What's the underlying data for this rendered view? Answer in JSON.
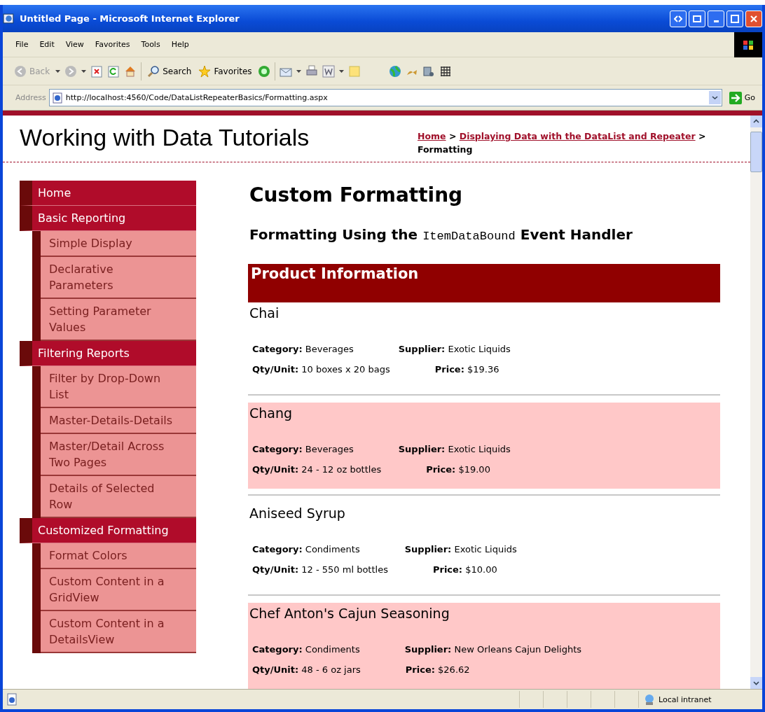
{
  "window": {
    "title": "Untitled Page - Microsoft Internet Explorer"
  },
  "menu": [
    "File",
    "Edit",
    "View",
    "Favorites",
    "Tools",
    "Help"
  ],
  "toolbar": {
    "back": "Back",
    "search": "Search",
    "favorites": "Favorites"
  },
  "address": {
    "label": "Address",
    "value": "http://localhost:4560/Code/DataListRepeaterBasics/Formatting.aspx",
    "go": "Go"
  },
  "site_title": "Working with Data Tutorials",
  "breadcrumb": [
    {
      "text": "Home",
      "kind": "link"
    },
    {
      "text": ">",
      "kind": "separator"
    },
    {
      "text": "Displaying Data with the DataList and Repeater",
      "kind": "link"
    },
    {
      "text": ">",
      "kind": "separator"
    },
    {
      "text": "Formatting",
      "kind": "current"
    }
  ],
  "sidebar": [
    {
      "label": "Home"
    },
    {
      "label": "Basic Reporting",
      "children": [
        "Simple Display",
        "Declarative Parameters",
        "Setting Parameter Values"
      ]
    },
    {
      "label": "Filtering Reports",
      "children": [
        "Filter by Drop-Down List",
        "Master-Details-Details",
        "Master/Detail Across Two Pages",
        "Details of Selected Row"
      ]
    },
    {
      "label": "Customized Formatting",
      "children": [
        "Format Colors",
        "Custom Content in a GridView",
        "Custom Content in a DetailsView"
      ]
    }
  ],
  "page_title": "Custom Formatting",
  "section_heading": [
    {
      "text": "Formatting Using the",
      "kind": "text"
    },
    {
      "text": "ItemDataBound",
      "kind": "code"
    },
    {
      "text": "Event Handler",
      "kind": "text"
    }
  ],
  "list_header": "Product Information",
  "products": [
    {
      "name": "Chai",
      "highlighted": false,
      "fields": [
        {
          "label": "Category:",
          "value": "Beverages"
        },
        {
          "label": "Supplier:",
          "value": "Exotic Liquids"
        },
        {
          "label": "Qty/Unit:",
          "value": "10 boxes x 20 bags"
        },
        {
          "label": "Price:",
          "value": "$19.36"
        }
      ]
    },
    {
      "name": "Chang",
      "highlighted": true,
      "fields": [
        {
          "label": "Category:",
          "value": "Beverages"
        },
        {
          "label": "Supplier:",
          "value": "Exotic Liquids"
        },
        {
          "label": "Qty/Unit:",
          "value": "24 - 12 oz bottles"
        },
        {
          "label": "Price:",
          "value": "$19.00"
        }
      ]
    },
    {
      "name": "Aniseed Syrup",
      "highlighted": false,
      "fields": [
        {
          "label": "Category:",
          "value": "Condiments"
        },
        {
          "label": "Supplier:",
          "value": "Exotic Liquids"
        },
        {
          "label": "Qty/Unit:",
          "value": "12 - 550 ml bottles"
        },
        {
          "label": "Price:",
          "value": "$10.00"
        }
      ]
    },
    {
      "name": "Chef Anton's Cajun Seasoning",
      "highlighted": true,
      "fields": [
        {
          "label": "Category:",
          "value": "Condiments"
        },
        {
          "label": "Supplier:",
          "value": "New Orleans Cajun Delights"
        },
        {
          "label": "Qty/Unit:",
          "value": "48 - 6 oz jars"
        },
        {
          "label": "Price:",
          "value": "$26.62"
        }
      ]
    }
  ],
  "status_bar": {
    "zone": "Local intranet"
  }
}
